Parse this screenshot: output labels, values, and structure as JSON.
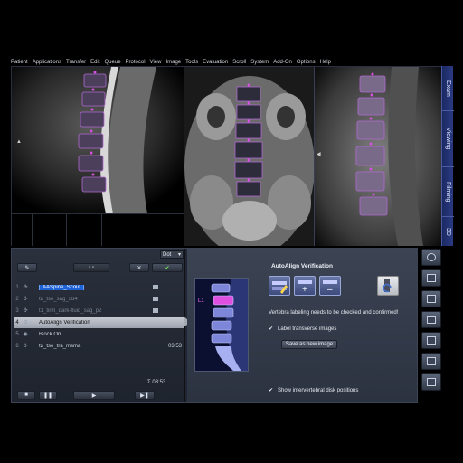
{
  "menu": [
    "Patient",
    "Applications",
    "Transfer",
    "Edit",
    "Queue",
    "Protocol",
    "View",
    "Image",
    "Tools",
    "Evaluation",
    "Scroll",
    "System",
    "Add-On",
    "Options",
    "Help"
  ],
  "tabs": [
    "Exam",
    "Viewing",
    "Filming",
    "3D"
  ],
  "toolbar": {
    "mode_select": "Dot"
  },
  "steps": [
    {
      "num": "1",
      "icon": "scout-icon",
      "label": "AASpine_Scout",
      "time": "",
      "state": "dim-selected"
    },
    {
      "num": "2",
      "icon": "scan-icon",
      "label": "t2_tse_sag_384",
      "time": "",
      "state": "dim"
    },
    {
      "num": "3",
      "icon": "scan-icon",
      "label": "t1_tirm_dark-fluid_sag_p2",
      "time": "",
      "state": "dim"
    },
    {
      "num": "4",
      "icon": "autoalign-icon",
      "label": "AutoAlign Verification",
      "time": "",
      "state": "active"
    },
    {
      "num": "5",
      "icon": "block-icon",
      "label": "Block On",
      "time": "",
      "state": "normal"
    },
    {
      "num": "6",
      "icon": "scan-icon",
      "label": "t2_tse_tra_msma",
      "time": "03:53",
      "state": "normal"
    }
  ],
  "total_time": "Σ 03:53",
  "autoalign": {
    "title": "AutoAlign Verification",
    "thumb_label": "L1",
    "message": "Vertebra labeling needs to be checked and confirmed!",
    "label_transverse": "Label transverse images",
    "save_button": "Save as new image",
    "show_disks": "Show intervertebral disk positions"
  }
}
